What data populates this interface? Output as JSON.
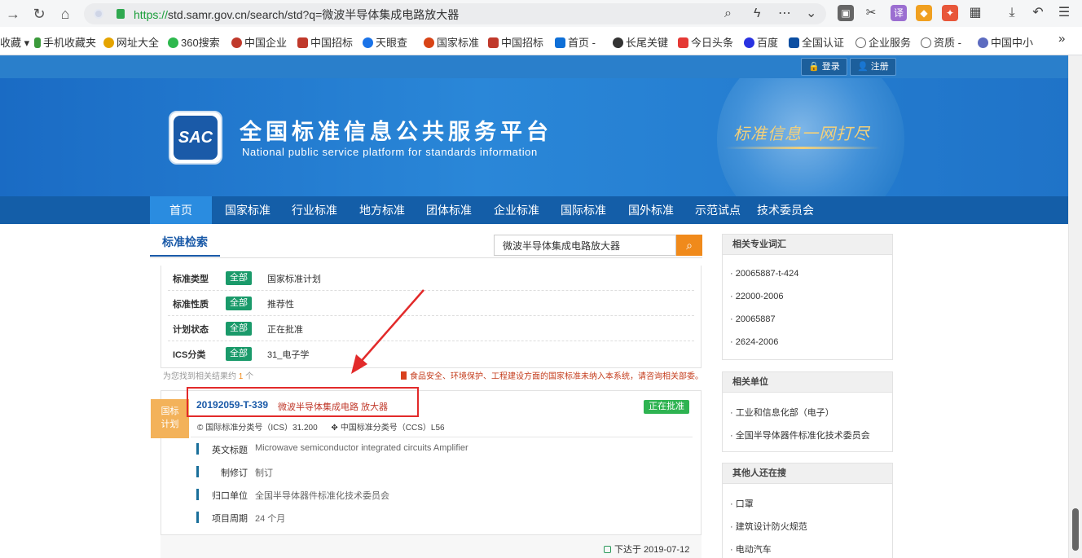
{
  "browser": {
    "url_scheme": "https://",
    "url_rest": "std.samr.gov.cn/search/std?q=微波半导体集成电路放大器",
    "bookmarks": [
      "收藏",
      "手机收藏夹",
      "网址大全",
      "360搜索",
      "中国企业",
      "中国招标",
      "天眼查",
      "国家标准",
      "中国招标",
      "首页 -",
      "长尾关键",
      "今日头条",
      "百度",
      "全国认证",
      "企业服务",
      "资质 -",
      "中国中小"
    ],
    "more": "»"
  },
  "header": {
    "login": "登录",
    "register": "注册",
    "logo_text": "SAC",
    "title": "全国标准信息公共服务平台",
    "subtitle": "National public service platform  for standards information",
    "slogan": "标准信息一网打尽"
  },
  "nav": [
    "首页",
    "国家标准",
    "行业标准",
    "地方标准",
    "团体标准",
    "企业标准",
    "国际标准",
    "国外标准",
    "示范试点",
    "技术委员会"
  ],
  "search": {
    "tab": "标准检索",
    "query": "微波半导体集成电路放大器"
  },
  "filters": [
    {
      "label": "标准类型",
      "all": "全部",
      "value": "国家标准计划"
    },
    {
      "label": "标准性质",
      "all": "全部",
      "value": "推荐性"
    },
    {
      "label": "计划状态",
      "all": "全部",
      "value": "正在批准"
    },
    {
      "label": "ICS分类",
      "all": "全部",
      "value": "31_电子学"
    }
  ],
  "results_info": {
    "prefix": "为您找到相关结果约",
    "count": "1",
    "suffix": "个",
    "notice": "食品安全、环境保护、工程建设方面的国家标准未纳入本系统，请咨询相关部委。"
  },
  "result": {
    "tag_line1": "国标",
    "tag_line2": "计划",
    "code": "20192059-T-339",
    "name": "微波半导体集成电路 放大器",
    "status": "正在批准",
    "ics": "国际标准分类号（ICS）31.200",
    "ccs": "中国标准分类号（CCS）L56",
    "details": [
      {
        "label": "英文标题",
        "value": "Microwave semiconductor integrated circuits Amplifier"
      },
      {
        "label": "制修订",
        "value": "制订"
      },
      {
        "label": "归口单位",
        "value": "全国半导体器件标准化技术委员会"
      },
      {
        "label": "项目周期",
        "value": "24 个月"
      }
    ],
    "issued": "下达于 2019-07-12"
  },
  "sidebar": {
    "related_terms": {
      "title": "相关专业词汇",
      "items": [
        "· 20065887-t-424",
        "· 22000-2006",
        "· 20065887",
        "· 2624-2006"
      ]
    },
    "related_units": {
      "title": "相关单位",
      "items": [
        "· 工业和信息化部（电子）",
        "· 全国半导体器件标准化技术委员会"
      ]
    },
    "others": {
      "title": "其他人还在搜",
      "items": [
        "· 口罩",
        "· 建筑设计防火规范",
        "· 电动汽车"
      ]
    }
  }
}
